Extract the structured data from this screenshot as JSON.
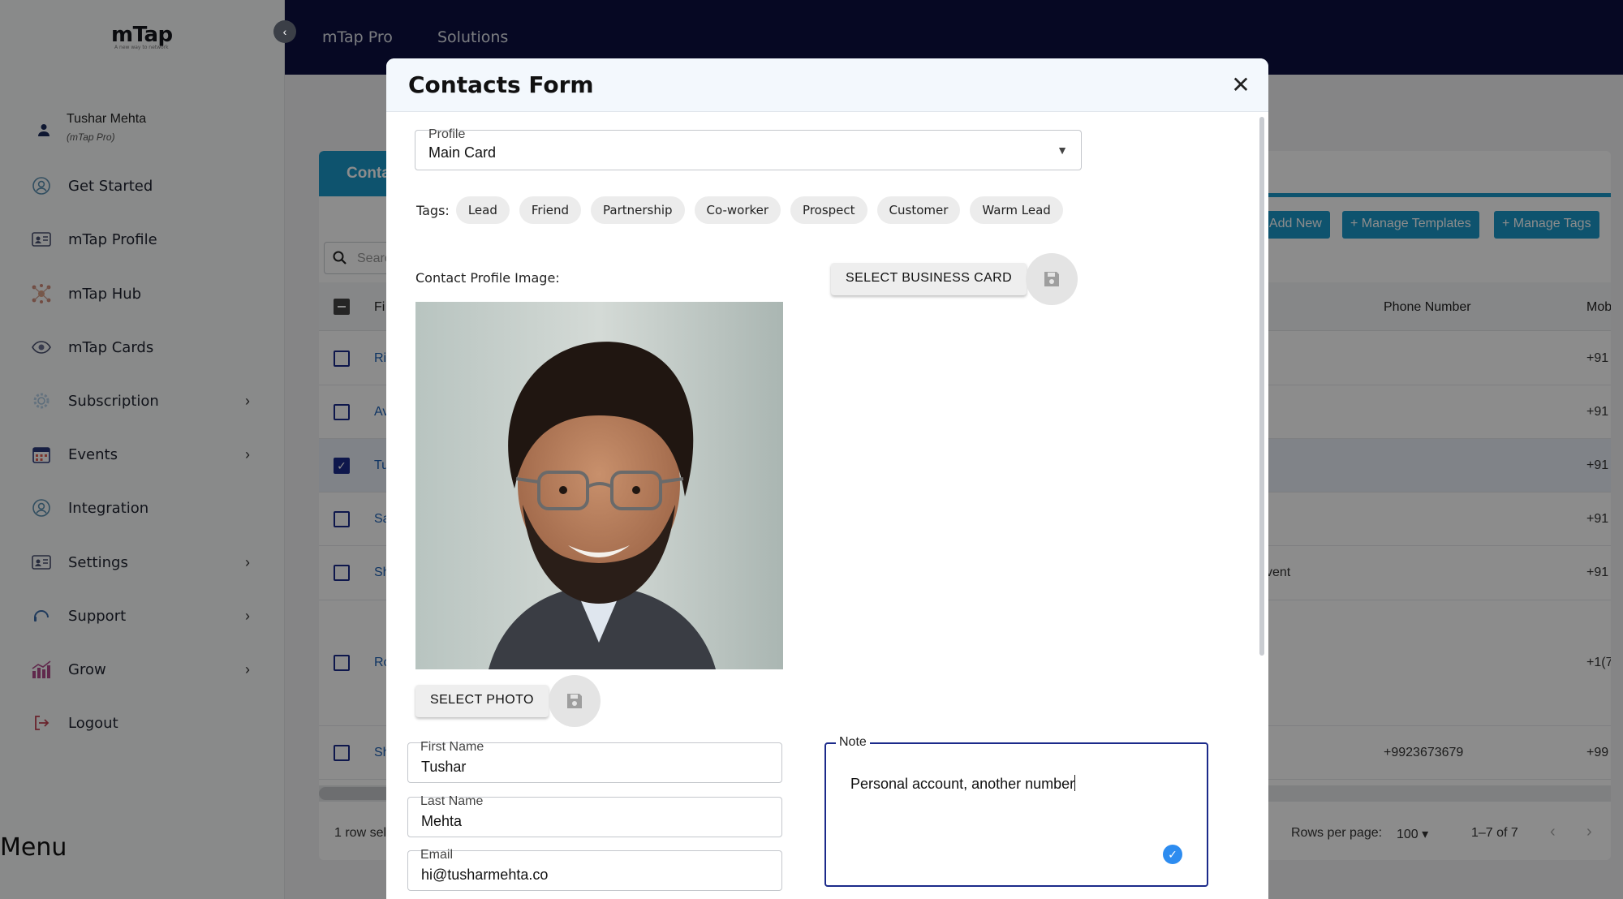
{
  "sidebar": {
    "logo": "mTap",
    "logo_tagline": "A new way to network",
    "user": {
      "name": "Tushar Mehta",
      "plan": "(mTap Pro)"
    },
    "items": [
      {
        "label": "Get Started",
        "icon": "user-circle-icon"
      },
      {
        "label": "mTap Profile",
        "icon": "id-card-icon"
      },
      {
        "label": "mTap Hub",
        "icon": "hub-icon"
      },
      {
        "label": "mTap Cards",
        "icon": "cards-icon"
      },
      {
        "label": "Subscription",
        "icon": "gear-icon"
      },
      {
        "label": "Events",
        "icon": "calendar-icon"
      },
      {
        "label": "Integration",
        "icon": "user-circle-icon"
      },
      {
        "label": "Settings",
        "icon": "id-card-icon"
      },
      {
        "label": "Support",
        "icon": "headset-icon"
      },
      {
        "label": "Grow",
        "icon": "chart-icon"
      },
      {
        "label": "Logout",
        "icon": "logout-icon"
      }
    ],
    "menu_label": "Menu"
  },
  "topbar": {
    "nav": [
      "mTap Pro",
      "Solutions"
    ]
  },
  "main": {
    "tab": "Conta",
    "search_placeholder": "Searc",
    "buttons": [
      "+ Add New",
      "+ Manage Templates",
      "+ Manage Tags"
    ],
    "columns": {
      "first": "Fi",
      "phone": "Phone Number",
      "mobile": "Mob"
    },
    "rows": [
      {
        "name": "Ri",
        "extra": "",
        "phone": "",
        "mobile": "+91",
        "checked": false
      },
      {
        "name": "Av",
        "extra": "",
        "phone": "",
        "mobile": "+91",
        "checked": false
      },
      {
        "name": "Tu",
        "extra": "",
        "phone": "",
        "mobile": "+91",
        "checked": true
      },
      {
        "name": "Sa",
        "extra": "",
        "phone": "",
        "mobile": "+91",
        "checked": false
      },
      {
        "name": "Sh",
        "extra": "vent",
        "phone": "",
        "mobile": "+91",
        "checked": false
      },
      {
        "name": "Ro",
        "extra": "",
        "phone": "",
        "mobile": "+1(7",
        "checked": false
      },
      {
        "name": "Sh",
        "extra": "",
        "phone": "+9923673679",
        "mobile": "+99",
        "checked": false
      }
    ],
    "footer": {
      "selected": "1 row sel",
      "rows_per_page_label": "Rows per page:",
      "rows_per_page": "100",
      "range": "1–7 of 7"
    }
  },
  "modal": {
    "title": "Contacts Form",
    "profile": {
      "label": "Profile",
      "value": "Main Card"
    },
    "tags_label": "Tags:",
    "tags": [
      "Lead",
      "Friend",
      "Partnership",
      "Co-worker",
      "Prospect",
      "Customer",
      "Warm Lead"
    ],
    "image_label": "Contact Profile Image:",
    "select_business_card": "SELECT BUSINESS CARD",
    "select_photo": "SELECT PHOTO",
    "first_name": {
      "label": "First Name",
      "value": "Tushar"
    },
    "last_name": {
      "label": "Last Name",
      "value": "Mehta"
    },
    "email": {
      "label": "Email",
      "value": "hi@tusharmehta.co"
    },
    "note": {
      "label": "Note",
      "value": "Personal account, another number"
    }
  },
  "colors": {
    "topbar": "#0c1040",
    "accent": "#1a98c8",
    "primary": "#1b2a8a",
    "check": "#2d8cf0"
  }
}
